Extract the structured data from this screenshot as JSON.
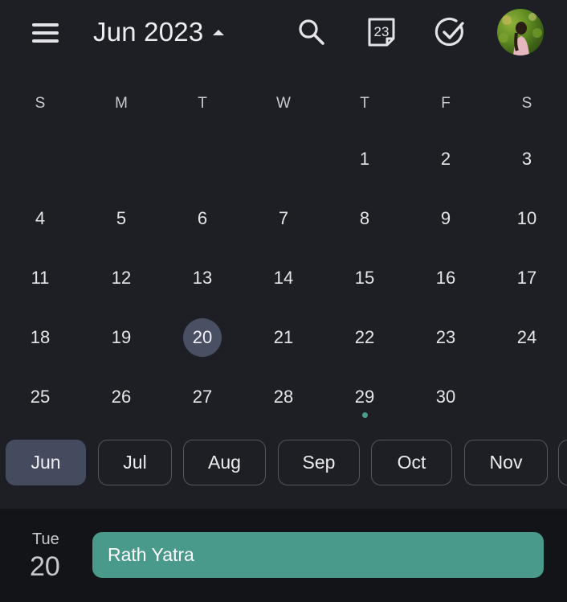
{
  "header": {
    "month_title": "Jun 2023",
    "today_number": "23",
    "icons": [
      "menu-icon",
      "caret-up-icon",
      "search-icon",
      "today-calendar-icon",
      "tasks-check-icon",
      "avatar"
    ]
  },
  "weekdays": [
    "S",
    "M",
    "T",
    "W",
    "T",
    "F",
    "S"
  ],
  "calendar": {
    "weeks": [
      [
        "",
        "",
        "",
        "",
        "1",
        "2",
        "3"
      ],
      [
        "4",
        "5",
        "6",
        "7",
        "8",
        "9",
        "10"
      ],
      [
        "11",
        "12",
        "13",
        "14",
        "15",
        "16",
        "17"
      ],
      [
        "18",
        "19",
        "20",
        "21",
        "22",
        "23",
        "24"
      ],
      [
        "25",
        "26",
        "27",
        "28",
        "29",
        "30",
        ""
      ]
    ],
    "selected_day": "20",
    "days_with_events": [
      "29"
    ]
  },
  "month_chips": [
    "Jun",
    "Jul",
    "Aug",
    "Sep",
    "Oct",
    "Nov"
  ],
  "active_month": "Jun",
  "agenda": {
    "day_of_week": "Tue",
    "date": "20",
    "event_title": "Rath Yatra"
  },
  "colors": {
    "background": "#1e1f24",
    "selected_day": "#4a5063",
    "event": "#4a9a8c",
    "event_dot": "#4b9e8e",
    "active_chip": "#454b5e"
  }
}
